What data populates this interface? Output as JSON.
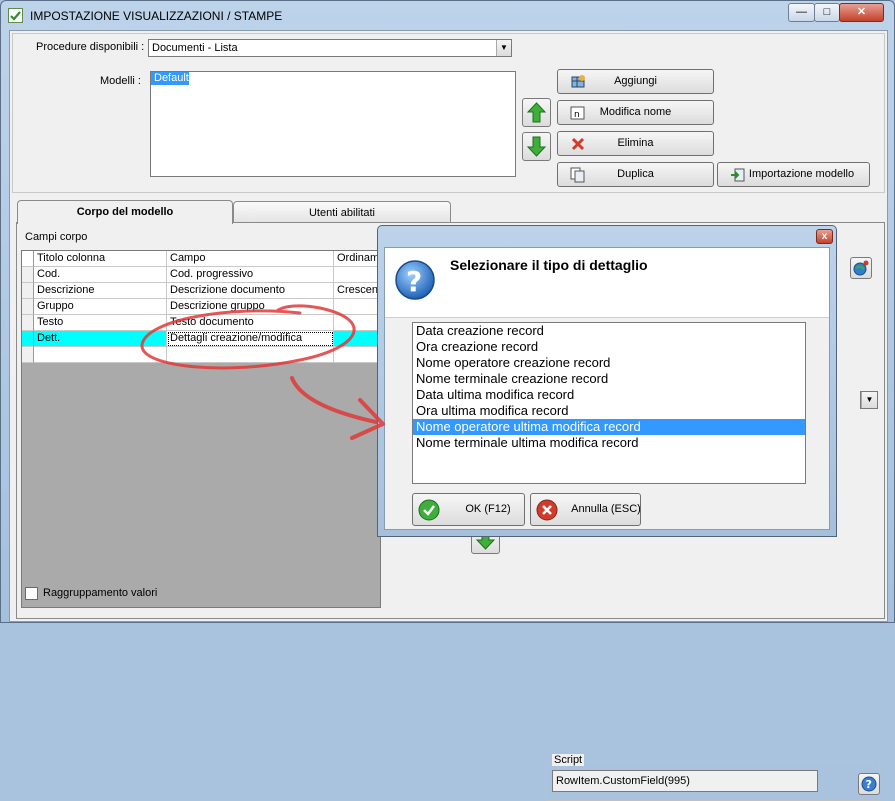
{
  "window": {
    "title": "IMPOSTAZIONE VISUALIZZAZIONI / STAMPE",
    "min_glyph": "—",
    "max_glyph": "□",
    "close_glyph": "✕"
  },
  "top": {
    "procedure_label": "Procedure disponibili :",
    "procedure_value": "Documenti - Lista",
    "models_label": "Modelli :",
    "models": [
      "Default"
    ],
    "buttons": {
      "add": "Aggiungi",
      "rename": "Modifica nome",
      "delete": "Elimina",
      "duplicate": "Duplica",
      "import": "Importazione modello"
    }
  },
  "tabs": [
    {
      "label": "Corpo del modello"
    },
    {
      "label": "Utenti abilitati"
    }
  ],
  "body": {
    "fields_label": "Campi corpo",
    "grid_headers": [
      "Titolo colonna",
      "Campo",
      "Ordinam"
    ],
    "grid_rows": [
      [
        "Cod.",
        "Cod. progressivo",
        ""
      ],
      [
        "Descrizione",
        "Descrizione documento",
        "Crescen"
      ],
      [
        "Gruppo",
        "Descrizione gruppo",
        ""
      ],
      [
        "Testo",
        "Testo documento",
        ""
      ],
      [
        "Dett.",
        "Dettagli creazione/modifica",
        ""
      ],
      [
        "",
        "",
        ""
      ]
    ],
    "grouping_label": "Raggruppamento valori",
    "script_label": "Script",
    "script_value": "RowItem.CustomField(995)"
  },
  "dialog": {
    "title": "Selezionare il tipo di dettaglio",
    "close_glyph": "x",
    "options": [
      "Data creazione record",
      "Ora creazione record",
      "Nome operatore creazione record",
      "Nome terminale creazione record",
      "Data ultima modifica record",
      "Ora ultima modifica record",
      "Nome operatore ultima modifica record",
      "Nome terminale ultima modifica record"
    ],
    "selected_index": 6,
    "ok_label": "OK (F12)",
    "cancel_label": "Annulla (ESC)"
  },
  "colors": {
    "selection": "#3399ff",
    "highlight_row": "#00ffff",
    "annotation": "#e03a3a",
    "up_arrow": "#3fae3a",
    "down_arrow": "#3fae3a"
  }
}
